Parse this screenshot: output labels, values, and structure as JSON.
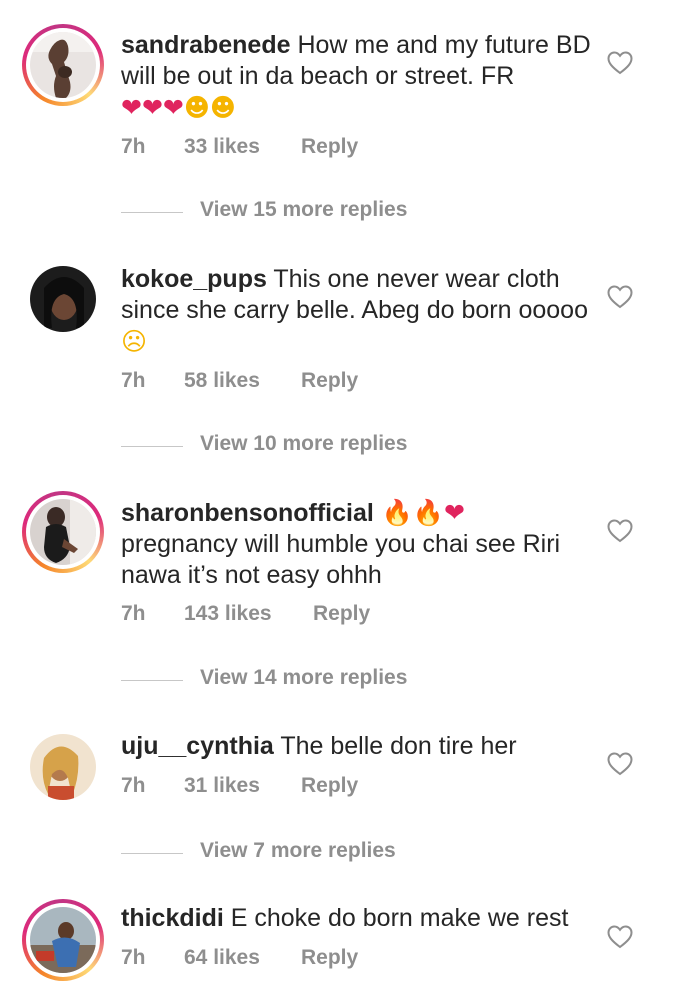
{
  "comments": [
    {
      "username": "sandrabenede",
      "text": " How me and my future BD will be out in da beach or street. FR ",
      "emojis": "❤️❤️❤️😍😍",
      "time": "7h",
      "likes": "33 likes",
      "reply": "Reply",
      "view_replies": "View 15 more replies",
      "has_story_ring": true
    },
    {
      "username": "kokoe_pups",
      "text": " This one never wear cloth since she carry belle. Abeg do born ooooo",
      "emojis": "😭",
      "time": "7h",
      "likes": "58 likes",
      "reply": "Reply",
      "view_replies": "View 10 more replies",
      "has_story_ring": false
    },
    {
      "username": "sharonbensonofficial",
      "emojis_after_name": " 🔥🔥❤️",
      "text": "pregnancy will humble you chai see Riri nawa it’s not easy ohhh",
      "time": "7h",
      "likes": "143 likes",
      "reply": "Reply",
      "view_replies": "View 14 more replies",
      "has_story_ring": true
    },
    {
      "username": "uju__cynthia",
      "text": " The belle don tire her",
      "time": "7h",
      "likes": "31 likes",
      "reply": "Reply",
      "view_replies": "View 7 more replies",
      "has_story_ring": false
    },
    {
      "username": "thickdidi",
      "text": " E choke do born make we rest",
      "time": "7h",
      "likes": "64 likes",
      "reply": "Reply",
      "has_story_ring": true
    }
  ],
  "icons": {
    "like": "heart-outline-icon"
  },
  "colors": {
    "text": "#262626",
    "muted": "#8e8e8e",
    "ring_start": "#f58529",
    "ring_end": "#dd2a7b"
  }
}
